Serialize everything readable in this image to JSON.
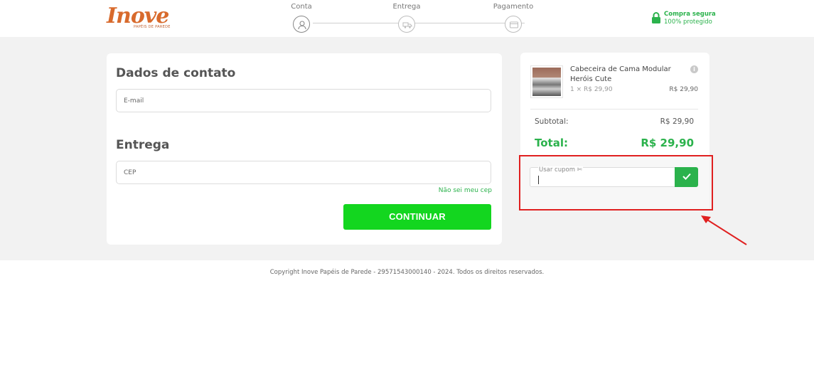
{
  "header": {
    "logo": {
      "text": "Inove",
      "subtext": "PAPÉIS DE PAREDE"
    },
    "steps": [
      {
        "label": "Conta",
        "icon": "user-icon",
        "active": true
      },
      {
        "label": "Entrega",
        "icon": "truck-icon",
        "active": false
      },
      {
        "label": "Pagamento",
        "icon": "card-icon",
        "active": false
      }
    ],
    "secure": {
      "title": "Compra segura",
      "subtitle": "100% protegido",
      "icon": "lock-icon",
      "color": "#2bb24c"
    }
  },
  "contact": {
    "title": "Dados de contato",
    "email_placeholder": "E-mail"
  },
  "delivery": {
    "title": "Entrega",
    "cep_placeholder": "CEP",
    "cep_link": "Não sei meu cep",
    "continue_label": "CONTINUAR",
    "continue_color": "#13d61f"
  },
  "summary": {
    "product": {
      "name": "Cabeceira de Cama Modular Heróis Cute",
      "qty": "1 × R$ 29,90",
      "price": "R$ 29,90"
    },
    "subtotal_label": "Subtotal:",
    "subtotal_value": "R$ 29,90",
    "total_label": "Total:",
    "total_value": "R$ 29,90",
    "coupon_label": "Usar cupom ✄",
    "coupon_button_icon": "check-icon"
  },
  "annotation": {
    "color": "#e02020"
  },
  "footer": {
    "copyright": "Copyright Inove Papéis de Parede - 29571543000140 - 2024. Todos os direitos reservados."
  }
}
